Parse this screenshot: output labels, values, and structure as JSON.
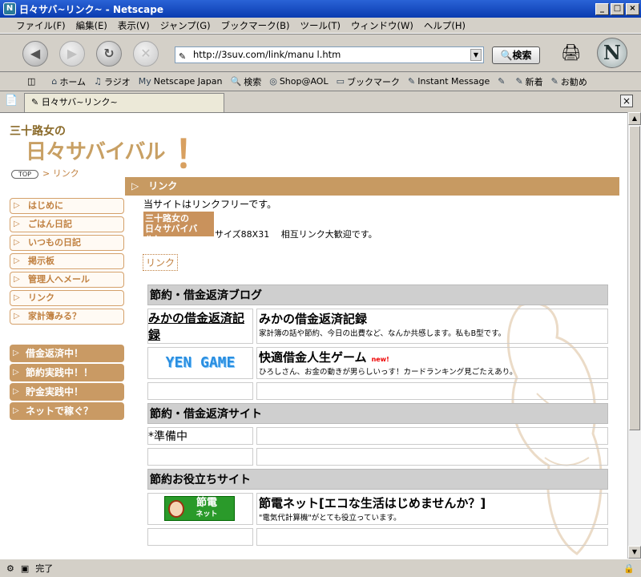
{
  "window": {
    "title": "日々サバ~リンク~ - Netscape"
  },
  "menu": [
    "ファイル(F)",
    "編集(E)",
    "表示(V)",
    "ジャンプ(G)",
    "ブックマーク(B)",
    "ツール(T)",
    "ウィンドウ(W)",
    "ヘルプ(H)"
  ],
  "nav": {
    "url": "http://3suv.com/link/manu l.htm",
    "search_label": "検索"
  },
  "bookmarks": [
    "ホーム",
    "ラジオ",
    "Netscape Japan",
    "検索",
    "Shop@AOL",
    "ブックマーク",
    "Instant Message",
    "新着",
    "お勧め"
  ],
  "tab": {
    "label": "日々サバ~リンク~"
  },
  "status": {
    "text": "完了"
  },
  "page": {
    "logo_small": "三十路女の",
    "logo_big": "日々サバイバル",
    "logo_bang": "！",
    "crumb_top": "TOP",
    "crumb_current": "> リンク",
    "heading": "リンク",
    "intro": "当サイトはリンクフリーです。",
    "banner_line1": "三十路女の",
    "banner_line2": "日々サバイバル！",
    "banner_text": "サイズ88X31　 相互リンク大歓迎です。",
    "link_label": "リンク"
  },
  "sidenav": [
    "はじめに",
    "ごはん日記",
    "いつもの日記",
    "掲示板",
    "管理人へメール",
    "リンク",
    "家計簿みる？"
  ],
  "sidenav2": [
    "借金返済中！",
    "節約実践中！！",
    "貯金実践中！",
    "ネットで稼ぐ？"
  ],
  "links": {
    "cat1": "節約・借金返済ブログ",
    "r1_left": "みかの借金返済記録",
    "r1_title": "みかの借金返済記録",
    "r1_desc": "家計簿の話や節約、今日の出費など、なんか共感します。私もB型です。",
    "r2_img": "YEN GAME",
    "r2_title": "快適借金人生ゲーム",
    "r2_new": "new!",
    "r2_desc": "ひろしさん、お金の動きが男らしいっす！カードランキング見ごたえあり。",
    "cat2": "節約・借金返済サイト",
    "r4_left": "*準備中",
    "cat3": "節約お役立ちサイト",
    "r6_img_line1": "節電",
    "r6_img_line2": "ネット",
    "r6_title": "節電ネット[エコな生活はじめませんか？]",
    "r6_desc": "\"電気代計算機\"がとても役立っています。"
  }
}
